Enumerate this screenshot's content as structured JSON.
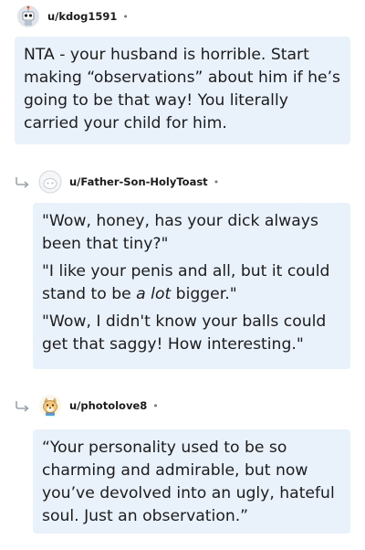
{
  "comments": [
    {
      "username": "u/kdog1591",
      "separator": "•",
      "avatar_icon": "snoo-robot-avatar-icon",
      "paragraphs": [
        "NTA - your husband is horrible. Start making “observations” about him if he’s going to be that way! You literally carried your child for him."
      ]
    },
    {
      "username": "u/Father-Son-HolyToast",
      "separator": "•",
      "avatar_icon": "default-snoo-avatar-icon",
      "paragraphs": [
        "\"Wow, honey, has your dick always been that tiny?\"",
        "\"I like your penis and all, but it could stand to be ",
        "\"Wow, I didn't know your balls could get that saggy! How interesting.\""
      ],
      "italic_fragment": "a lot",
      "after_italic": " bigger.\""
    },
    {
      "username": "u/photolove8",
      "separator": "•",
      "avatar_icon": "doge-snoo-avatar-icon",
      "paragraphs": [
        "“Your personality used to be so charming and admirable, but now you’ve devolved into an ugly, hateful soul. Just an observation.”"
      ]
    }
  ],
  "colors": {
    "bubble_bg": "#e9f2fb",
    "username": "#1c1c1c",
    "meta": "#7c7c7c"
  }
}
